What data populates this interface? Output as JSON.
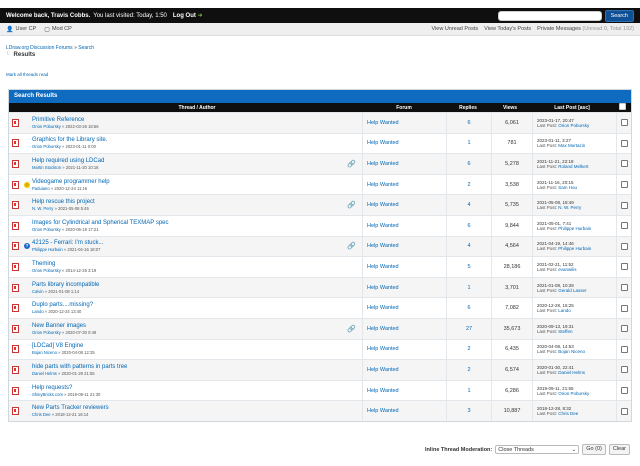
{
  "welcome": {
    "greeting": "Welcome back, Travis Cobbs.",
    "last_visit": "You last visited: Today, 1:50",
    "logout": "Log Out",
    "search_button": "Search"
  },
  "panel": {
    "user_cp": "User CP",
    "mod_cp": "Mod CP",
    "view_unread": "View Unread Posts",
    "view_today": "View Today's Posts",
    "pm": "Private Messages",
    "pm_count": "(Unread 0, Total 192)"
  },
  "breadcrumb": {
    "forum": "LDraw.org Discussion Forums",
    "sep": "»",
    "search": "Search",
    "title": "Results"
  },
  "mark_read": "Mark all threads read",
  "table": {
    "caption": "Search Results",
    "headers": {
      "thread": "Thread / Author",
      "forum": "Forum",
      "replies": "Replies",
      "views": "Views",
      "last_post": "Last Post [asc]"
    },
    "rows": [
      {
        "title": "Primitive Reference",
        "author": "Orion Pobursky",
        "date": "» 2022-03-26 18:56",
        "forum": "Help Wanted",
        "replies": "6",
        "views": "6,061",
        "lp_date": "2023-01-17, 20:47",
        "lp_label": "Last Post:",
        "lp_author": "Orion Pobursky",
        "icon": "",
        "attach": false
      },
      {
        "title": "Graphics for the Library site.",
        "author": "Orion Pobursky",
        "date": "» 2023-01-11 0:00",
        "forum": "Help Wanted",
        "replies": "1",
        "views": "781",
        "lp_date": "2023-01-11, 3:27",
        "lp_label": "Last Post:",
        "lp_author": "Max Murtazin",
        "icon": "",
        "attach": false
      },
      {
        "title": "Help required using LDCad",
        "author": "Martin Stockton",
        "date": "» 2021-11-20 10:18",
        "forum": "Help Wanted",
        "replies": "6",
        "views": "5,278",
        "lp_date": "2021-11-21, 22:18",
        "lp_label": "Last Post:",
        "lp_author": "Roland Melkert",
        "icon": "",
        "attach": true
      },
      {
        "title": "Videogame programmer help",
        "author": "Paduiano",
        "date": "» 2020-12-24 11:16",
        "forum": "Help Wanted",
        "replies": "2",
        "views": "3,538",
        "lp_date": "2021-11-16, 20:15",
        "lp_label": "Last Post:",
        "lp_author": "Sam Hou",
        "icon": "smile",
        "attach": false
      },
      {
        "title": "Help rescue this project",
        "author": "N. W. Perry",
        "date": "» 2021-05-08 5:45",
        "forum": "Help Wanted",
        "replies": "4",
        "views": "5,735",
        "lp_date": "2021-05-08, 18:49",
        "lp_label": "Last Post:",
        "lp_author": "N. W. Perry",
        "icon": "",
        "attach": true
      },
      {
        "title": "Images for Cylindrical and Spherical TEXMAP spec",
        "author": "Orion Pobursky",
        "date": "» 2020-06-19 17:21",
        "forum": "Help Wanted",
        "replies": "6",
        "views": "9,844",
        "lp_date": "2021-05-01, 7:41",
        "lp_label": "Last Post:",
        "lp_author": "Philippe Hurbain",
        "icon": "",
        "attach": false
      },
      {
        "title": "42125 - Ferrari: I'm stuck...",
        "author": "Philippe Hurbain",
        "date": "» 2021-04-16 18:07",
        "forum": "Help Wanted",
        "replies": "4",
        "views": "4,564",
        "lp_date": "2021-04-19, 14:46",
        "lp_label": "Last Post:",
        "lp_author": "Philippe Hurbain",
        "icon": "question",
        "attach": true
      },
      {
        "title": "Theming",
        "author": "Orion Pobursky",
        "date": "» 2014-12-25 3:19",
        "forum": "Help Wanted",
        "replies": "5",
        "views": "28,186",
        "lp_date": "2021-02-21, 11:52",
        "lp_label": "Last Post:",
        "lp_author": "evanwilis",
        "icon": "",
        "attach": false
      },
      {
        "title": "Parts library incompatible",
        "author": "Calvin",
        "date": "» 2021-01-08 1:14",
        "forum": "Help Wanted",
        "replies": "1",
        "views": "3,701",
        "lp_date": "2021-01-08, 10:28",
        "lp_label": "Last Post:",
        "lp_author": "Gerald Lasser",
        "icon": "",
        "attach": false
      },
      {
        "title": "Duplo parts....missing?",
        "author": "Lando",
        "date": "» 2020-12-24 13:40",
        "forum": "Help Wanted",
        "replies": "6",
        "views": "7,082",
        "lp_date": "2020-12-28, 15:25",
        "lp_label": "Last Post:",
        "lp_author": "Lando",
        "icon": "",
        "attach": false
      },
      {
        "title": "New Banner images",
        "author": "Orion Pobursky",
        "date": "» 2020-07-30 0:49",
        "forum": "Help Wanted",
        "replies": "27",
        "views": "35,673",
        "lp_date": "2020-09-13, 19:31",
        "lp_label": "Last Post:",
        "lp_author": "Steffen",
        "icon": "",
        "attach": true
      },
      {
        "title": "[LDCad] V8 Engine",
        "author": "Bojan Niceno",
        "date": "» 2020-04-08 12:35",
        "forum": "Help Wanted",
        "replies": "2",
        "views": "6,435",
        "lp_date": "2020-04-08, 14:53",
        "lp_label": "Last Post:",
        "lp_author": "Bojan Niceno",
        "icon": "",
        "attach": false
      },
      {
        "title": "hide parts with patterns in parts tree",
        "author": "Daniel Helms",
        "date": "» 2020-01-29 21:55",
        "forum": "Help Wanted",
        "replies": "2",
        "views": "6,574",
        "lp_date": "2020-01-30, 22:41",
        "lp_label": "Last Post:",
        "lp_author": "Daniel Helms",
        "icon": "",
        "attach": false
      },
      {
        "title": "Help requests?",
        "author": "ShinyBricks.com",
        "date": "» 2019-09-11 21:30",
        "forum": "Help Wanted",
        "replies": "1",
        "views": "6,286",
        "lp_date": "2019-09-11, 21:55",
        "lp_label": "Last Post:",
        "lp_author": "Orion Pobursky",
        "icon": "",
        "attach": false
      },
      {
        "title": "New Parts Tracker reviewers",
        "author": "Chris Dee",
        "date": "» 2018-12-21 16:14",
        "forum": "Help Wanted",
        "replies": "3",
        "views": "10,887",
        "lp_date": "2018-12-28, 8:32",
        "lp_label": "Last Post:",
        "lp_author": "Chris Dee",
        "icon": "",
        "attach": false
      }
    ]
  },
  "moderation": {
    "label": "Inline Thread Moderation:",
    "selected": "Close Threads",
    "go": "Go (0)",
    "clear": "Clear"
  },
  "colors": {
    "header_bar": "#0f0f0f",
    "caption": "#0f6bbf",
    "link": "#0066b3",
    "accent_green": "#7ec242"
  }
}
